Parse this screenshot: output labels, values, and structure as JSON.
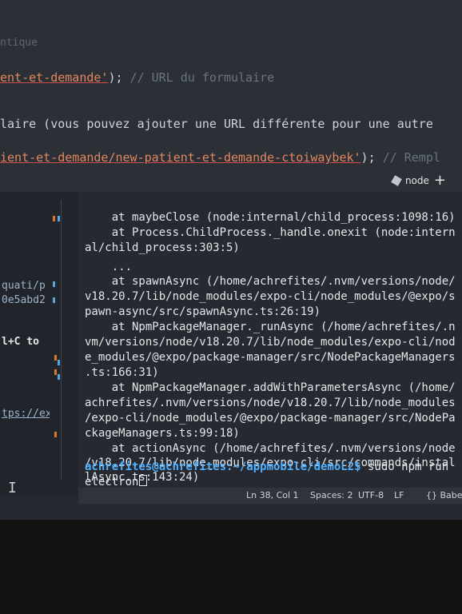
{
  "editor": {
    "line_top": "ntique",
    "line_url": {
      "string": "ent-et-demande'",
      "punct": ");",
      "comment": " // URL du formulaire"
    },
    "line_comment": "laire (vous pouvez ajouter une URL différente pour une autre",
    "line_second_url": {
      "string": "ient-et-demande/new-patient-et-demande-ctoiwaybek'",
      "punct": ");",
      "comment": " // Rempl"
    }
  },
  "terminal_tab": {
    "label": "node",
    "new_terminal": "+"
  },
  "explorer": {
    "items": [
      "quati/p",
      "0e5abd2",
      "l+C to",
      "tps://exp"
    ]
  },
  "terminal": {
    "lines": [
      "    at maybeClose (node:internal/child_process:1098:16)",
      "    at Process.ChildProcess._handle.onexit (node:intern",
      "al/child_process:303:5)",
      "    ...",
      "    at spawnAsync (/home/achrefites/.nvm/versions/node/",
      "v18.20.7/lib/node_modules/expo-cli/node_modules/@expo/s",
      "pawn-async/src/spawnAsync.ts:26:19)",
      "    at NpmPackageManager._runAsync (/home/achrefites/.n",
      "vm/versions/node/v18.20.7/lib/node_modules/expo-cli/nod",
      "e_modules/@expo/package-manager/src/NodePackageManagers",
      ".ts:166:31)",
      "    at NpmPackageManager.addWithParametersAsync (/home/",
      "achrefites/.nvm/versions/node/v18.20.7/lib/node_modules",
      "/expo-cli/node_modules/@expo/package-manager/src/NodePa",
      "ckageManagers.ts:99:18)",
      "    at actionAsync (/home/achrefites/.nvm/versions/node",
      "/v18.20.7/lib/node_modules/expo-cli/src/commands/instal",
      "lAsync.ts:143:24)"
    ],
    "prompt": "achrefites@achrefites:~/appmobile/demoL2$",
    "command": " sudo npm run",
    "command_cont": "electron"
  },
  "statusbar": {
    "position": "Ln 38, Col 1",
    "spaces": "Spaces: 2",
    "encoding": "UTF-8",
    "eol": "LF",
    "language": "{} Babe"
  },
  "colors": {
    "string": "#e2875f",
    "prompt": "#4fb0ff",
    "background": "#262a30"
  }
}
